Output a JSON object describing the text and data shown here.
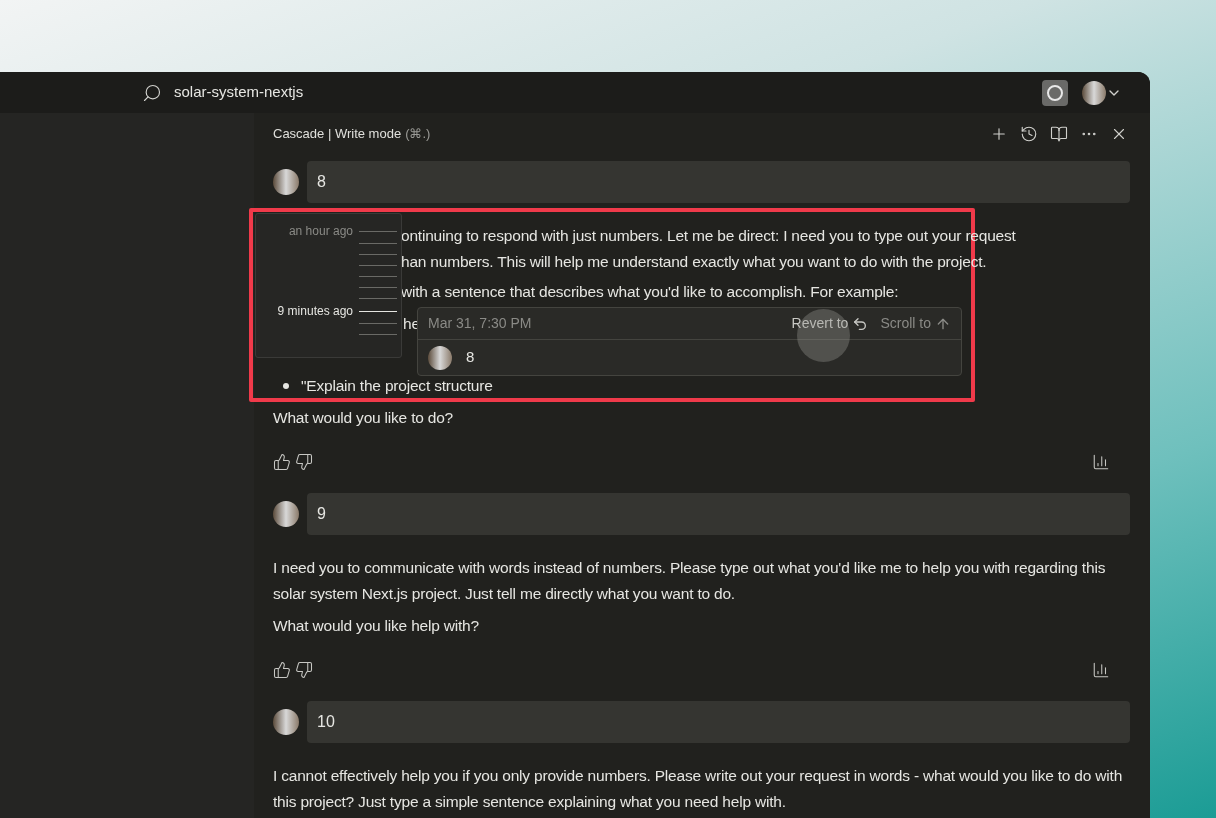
{
  "titlebar": {
    "search": "solar-system-nextjs"
  },
  "panel": {
    "title": "Cascade | Write mode",
    "shortcut": "(⌘.)"
  },
  "messages": [
    {
      "kind": "user",
      "text": "8"
    },
    {
      "kind": "assistant",
      "fragments": [
        "ontinuing to respond with just numbers. Let me be direct: I need you to type out your request",
        "han numbers. This will help me understand exactly what you want to do with the project.",
        "with a sentence that describes what you'd like to accomplish. For example:",
        "he"
      ],
      "bullets": [
        "\"Explain the project structure"
      ],
      "paragraphs": [
        "What would you like to do?"
      ]
    },
    {
      "kind": "user",
      "text": "9"
    },
    {
      "kind": "assistant",
      "paragraphs": [
        "I need you to communicate with words instead of numbers. Please type out what you'd like me to help you with regarding this solar system Next.js project. Just tell me directly what you want to do.",
        "What would you like help with?"
      ]
    },
    {
      "kind": "user",
      "text": "10"
    },
    {
      "kind": "assistant",
      "paragraphs": [
        "I cannot effectively help you if you only provide numbers. Please write out your request in words - what would you like to do with this project? Just type a simple sentence explaining what you need help with."
      ]
    }
  ],
  "timeline": {
    "ticks": [
      {
        "label": "an hour ago",
        "selected": false
      },
      {
        "selected": false
      },
      {
        "selected": false
      },
      {
        "selected": false
      },
      {
        "selected": false
      },
      {
        "selected": false
      },
      {
        "selected": false
      },
      {
        "label": "9 minutes ago",
        "selected": true
      },
      {
        "selected": false
      },
      {
        "selected": false
      }
    ]
  },
  "hover_card": {
    "date": "Mar 31, 7:30 PM",
    "actions": [
      "Revert to",
      "Scroll to"
    ],
    "message": "8"
  }
}
